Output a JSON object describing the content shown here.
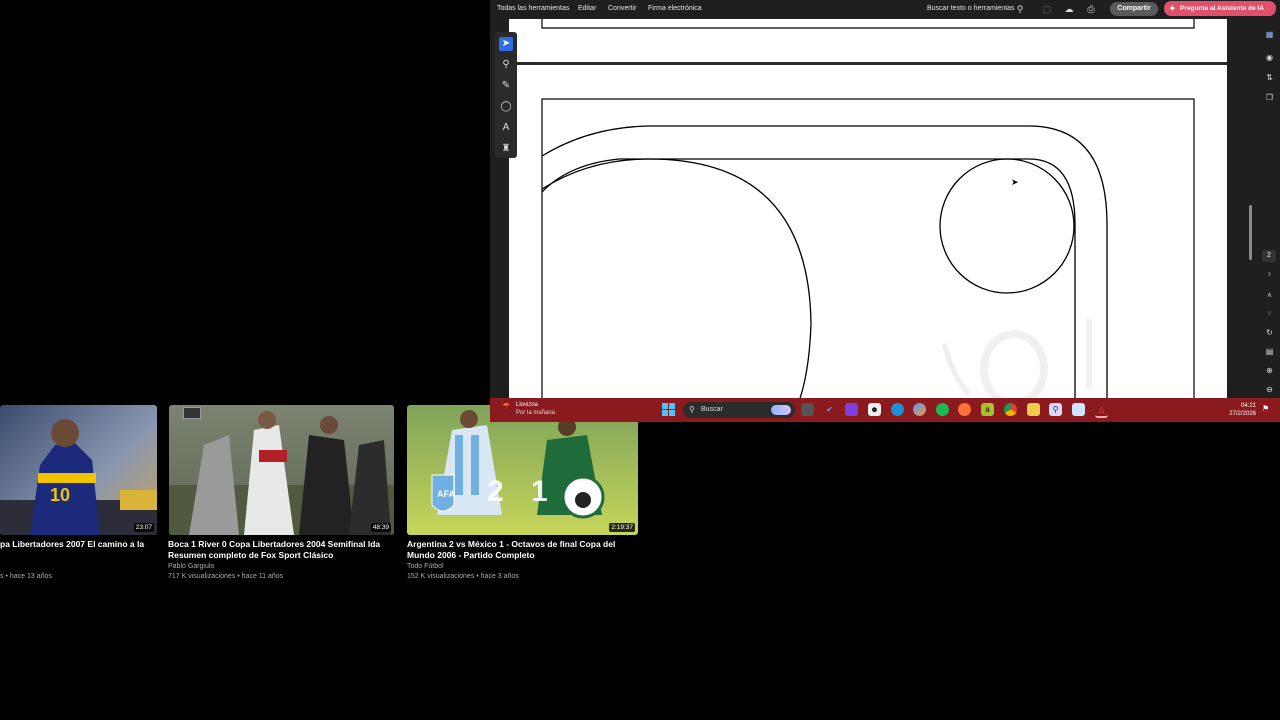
{
  "pdf": {
    "menu": [
      "Todas las herramientas",
      "Editar",
      "Convertir",
      "Firma electrónica"
    ],
    "search_tools": "Buscar texto o herramientas",
    "share_label": "Compartir",
    "ai_label": "Pregunta al Asistente de IA",
    "page_number": "2",
    "left_tools": [
      "cursor-icon",
      "zoom-icon",
      "pen-icon",
      "lasso-icon",
      "text-select-icon",
      "stamp-icon"
    ]
  },
  "taskbar": {
    "weather_title": "Llovizna",
    "weather_sub": "Por la mañana",
    "search_placeholder": "Buscar",
    "time": "04:21",
    "date": "27/2/2026"
  },
  "videos": [
    {
      "title_line1": "pa Libertadores 2007 El camino a la",
      "title_line2": "",
      "channel": "",
      "meta": "s • hace 13 años",
      "duration": "23:07",
      "jersey_number": "10"
    },
    {
      "title_line1": "Boca 1 River 0 Copa Libertadores 2004 Semifinal Ida",
      "title_line2": "Resumen completo de Fox Sport Clásico",
      "channel": "Pablo Gargiulo",
      "meta": "717 K visualizaciones • hace 11 años",
      "duration": "48:39"
    },
    {
      "title_line1": "Argentina 2 vs México 1 - Octavos de final Copa del",
      "title_line2": "Mundo 2006 - Partido Completo",
      "channel": "Todo Fútbol",
      "meta": "152 K visualizaciones • hace 3 años",
      "duration": "2:19:37",
      "score_home": "2",
      "score_away": "1",
      "home_badge": "AFA"
    }
  ]
}
